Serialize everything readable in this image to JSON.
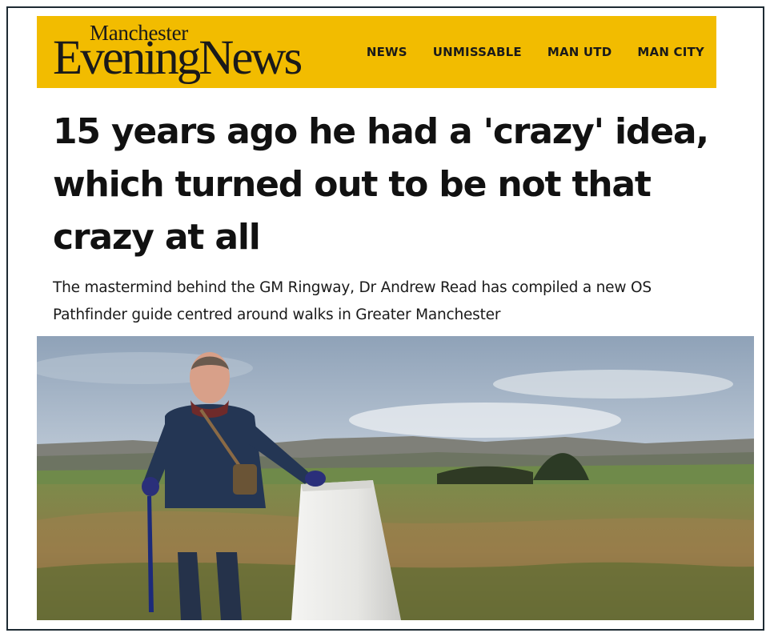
{
  "brand": {
    "line1": "Manchester",
    "line2": "EveningNews",
    "color": "#f2bc00"
  },
  "nav": {
    "items": [
      {
        "label": "NEWS"
      },
      {
        "label": "UNMISSABLE"
      },
      {
        "label": "MAN UTD"
      },
      {
        "label": "MAN CITY"
      }
    ]
  },
  "article": {
    "headline": "15 years ago he had a 'crazy' idea, which turned out to be not that crazy at all",
    "standfirst": "The mastermind behind the GM Ringway, Dr Andrew Read has compiled a new OS Pathfinder guide centred around walks in Greater Manchester"
  }
}
